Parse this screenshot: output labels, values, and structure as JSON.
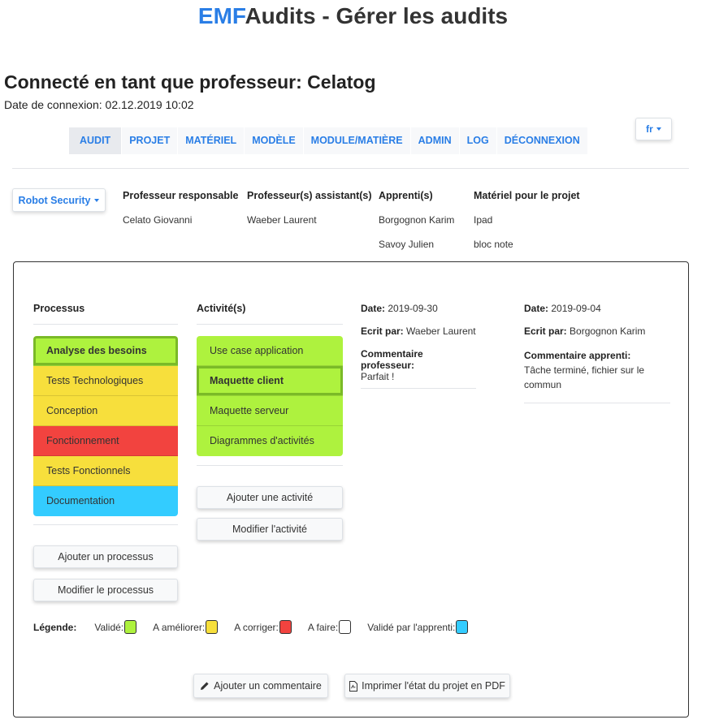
{
  "header": {
    "brand": "EMF",
    "title_rest": "Audits - Gérer les audits"
  },
  "connection": {
    "title": "Connecté en tant que professeur: Celatog",
    "date": "Date de connexion: 02.12.2019 10:02"
  },
  "nav": {
    "items": [
      {
        "label": "AUDIT",
        "active": true
      },
      {
        "label": "PROJET"
      },
      {
        "label": "MATÉRIEL"
      },
      {
        "label": "MODÈLE"
      },
      {
        "label": "MODULE/MATIÈRE"
      },
      {
        "label": "ADMIN"
      },
      {
        "label": "LOG"
      },
      {
        "label": "DÉCONNEXION"
      }
    ],
    "lang": "fr"
  },
  "project": {
    "selector": "Robot Security",
    "responsible_header": "Professeur responsable",
    "responsible": "Celato Giovanni",
    "assistant_header": "Professeur(s) assistant(s)",
    "assistant": "Waeber Laurent",
    "apprentices_header": "Apprenti(s)",
    "apprentices": [
      "Borgognon Karim",
      "Savoy Julien"
    ],
    "material_header": "Matériel pour le projet",
    "material": [
      "Ipad",
      "bloc note"
    ]
  },
  "processes": {
    "header": "Processus",
    "items": [
      {
        "label": "Analyse des besoins",
        "status": "valid",
        "selected": true
      },
      {
        "label": "Tests Technologiques",
        "status": "improve"
      },
      {
        "label": "Conception",
        "status": "improve"
      },
      {
        "label": "Fonctionnement",
        "status": "fix"
      },
      {
        "label": "Tests Fonctionnels",
        "status": "improve"
      },
      {
        "label": "Documentation",
        "status": "apprentice"
      }
    ],
    "add_label": "Ajouter un processus",
    "edit_label": "Modifier le processus"
  },
  "activities": {
    "header": "Activité(s)",
    "items": [
      {
        "label": "Use case application",
        "status": "valid"
      },
      {
        "label": "Maquette client",
        "status": "valid",
        "selected": true
      },
      {
        "label": "Maquette serveur",
        "status": "valid"
      },
      {
        "label": "Diagrammes d'activités",
        "status": "valid"
      }
    ],
    "add_label": "Ajouter une activité",
    "edit_label": "Modifier l'activité"
  },
  "comments": [
    {
      "date_label": "Date:",
      "date": "2019-09-30",
      "author_label": "Ecrit par:",
      "author": "Waeber Laurent",
      "comment_label": "Commentaire professeur:",
      "comment": "Parfait !"
    },
    {
      "date_label": "Date:",
      "date": "2019-09-04",
      "author_label": "Ecrit par:",
      "author": "Borgognon Karim",
      "comment_label": "Commentaire apprenti:",
      "comment": "Tâche terminé, fichier sur le commun"
    }
  ],
  "legend": {
    "title": "Légende:",
    "items": [
      {
        "label": "Validé:",
        "color": "#aef23e"
      },
      {
        "label": "A améliorer:",
        "color": "#f7df3c"
      },
      {
        "label": "A corriger:",
        "color": "#f2433f"
      },
      {
        "label": "A faire:",
        "color": "#ffffff"
      },
      {
        "label": "Validé par l'apprenti:",
        "color": "#33ccff"
      }
    ]
  },
  "footer": {
    "add_comment": "Ajouter un commentaire",
    "print_pdf": "Imprimer l'état du projet en PDF"
  },
  "colors": {
    "accent": "#2a7ee6",
    "valid": "#aef23e",
    "improve": "#f7df3c",
    "fix": "#f2433f",
    "todo": "#ffffff",
    "apprentice": "#33ccff"
  },
  "icons": {
    "add_comment": "pencil-icon",
    "print_pdf": "pdf-file-icon"
  }
}
